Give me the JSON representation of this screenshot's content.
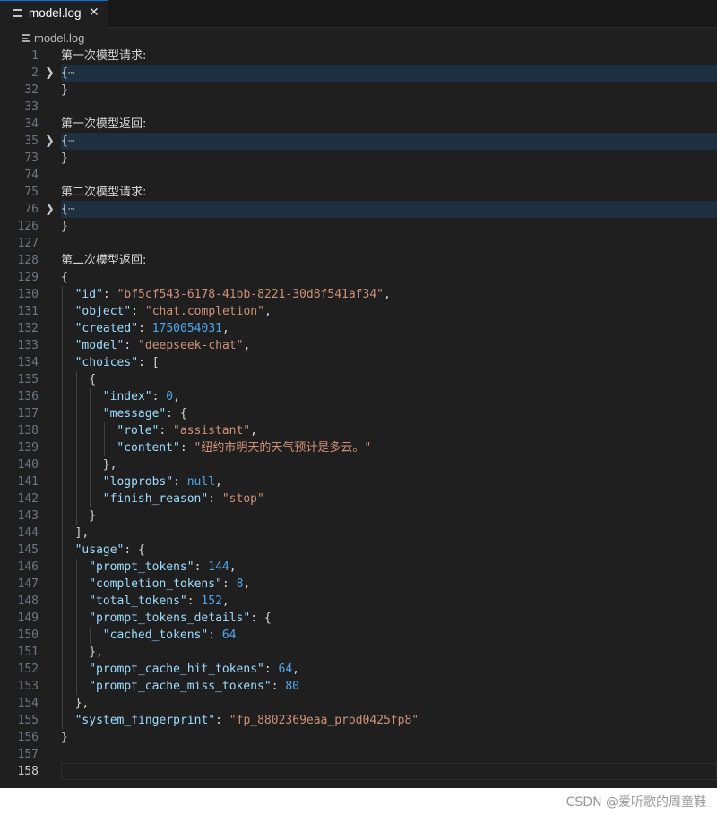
{
  "tab": {
    "label": "model.log",
    "icon": "file-lines-icon",
    "close_glyph": "✕"
  },
  "breadcrumb": {
    "label": "model.log",
    "icon": "file-lines-icon"
  },
  "lines": [
    {
      "n": "1",
      "indent": 0,
      "tokens": [
        [
          "c",
          "第一次模型请求:"
        ]
      ]
    },
    {
      "n": "2",
      "indent": 0,
      "fold": true,
      "tokens": [
        [
          "p",
          "{"
        ],
        [
          "d",
          "⋯"
        ]
      ]
    },
    {
      "n": "32",
      "indent": 0,
      "tokens": [
        [
          "p",
          "}"
        ]
      ]
    },
    {
      "n": "33",
      "indent": 0,
      "tokens": []
    },
    {
      "n": "34",
      "indent": 0,
      "tokens": [
        [
          "c",
          "第一次模型返回:"
        ]
      ]
    },
    {
      "n": "35",
      "indent": 0,
      "fold": true,
      "tokens": [
        [
          "p",
          "{"
        ],
        [
          "d",
          "⋯"
        ]
      ]
    },
    {
      "n": "73",
      "indent": 0,
      "tokens": [
        [
          "p",
          "}"
        ]
      ]
    },
    {
      "n": "74",
      "indent": 0,
      "tokens": []
    },
    {
      "n": "75",
      "indent": 0,
      "tokens": [
        [
          "c",
          "第二次模型请求:"
        ]
      ]
    },
    {
      "n": "76",
      "indent": 0,
      "fold": true,
      "tokens": [
        [
          "p",
          "{"
        ],
        [
          "d",
          "⋯"
        ]
      ]
    },
    {
      "n": "126",
      "indent": 0,
      "tokens": [
        [
          "p",
          "}"
        ]
      ]
    },
    {
      "n": "127",
      "indent": 0,
      "tokens": []
    },
    {
      "n": "128",
      "indent": 0,
      "tokens": [
        [
          "c",
          "第二次模型返回:"
        ]
      ]
    },
    {
      "n": "129",
      "indent": 0,
      "tokens": [
        [
          "p",
          "{"
        ]
      ]
    },
    {
      "n": "130",
      "indent": 1,
      "tokens": [
        [
          "k",
          "\"id\""
        ],
        [
          "p",
          ": "
        ],
        [
          "s",
          "\"bf5cf543-6178-41bb-8221-30d8f541af34\""
        ],
        [
          "p",
          ","
        ]
      ]
    },
    {
      "n": "131",
      "indent": 1,
      "tokens": [
        [
          "k",
          "\"object\""
        ],
        [
          "p",
          ": "
        ],
        [
          "s",
          "\"chat.completion\""
        ],
        [
          "p",
          ","
        ]
      ]
    },
    {
      "n": "132",
      "indent": 1,
      "tokens": [
        [
          "k",
          "\"created\""
        ],
        [
          "p",
          ": "
        ],
        [
          "n",
          "1750054031"
        ],
        [
          "p",
          ","
        ]
      ]
    },
    {
      "n": "133",
      "indent": 1,
      "tokens": [
        [
          "k",
          "\"model\""
        ],
        [
          "p",
          ": "
        ],
        [
          "s",
          "\"deepseek-chat\""
        ],
        [
          "p",
          ","
        ]
      ]
    },
    {
      "n": "134",
      "indent": 1,
      "tokens": [
        [
          "k",
          "\"choices\""
        ],
        [
          "p",
          ": ["
        ]
      ]
    },
    {
      "n": "135",
      "indent": 2,
      "tokens": [
        [
          "p",
          "{"
        ]
      ]
    },
    {
      "n": "136",
      "indent": 3,
      "tokens": [
        [
          "k",
          "\"index\""
        ],
        [
          "p",
          ": "
        ],
        [
          "n",
          "0"
        ],
        [
          "p",
          ","
        ]
      ]
    },
    {
      "n": "137",
      "indent": 3,
      "tokens": [
        [
          "k",
          "\"message\""
        ],
        [
          "p",
          ": {"
        ]
      ]
    },
    {
      "n": "138",
      "indent": 4,
      "tokens": [
        [
          "k",
          "\"role\""
        ],
        [
          "p",
          ": "
        ],
        [
          "s",
          "\"assistant\""
        ],
        [
          "p",
          ","
        ]
      ]
    },
    {
      "n": "139",
      "indent": 4,
      "tokens": [
        [
          "k",
          "\"content\""
        ],
        [
          "p",
          ": "
        ],
        [
          "s",
          "\"纽约市明天的天气预计是多云。\""
        ]
      ]
    },
    {
      "n": "140",
      "indent": 3,
      "tokens": [
        [
          "p",
          "},"
        ]
      ]
    },
    {
      "n": "141",
      "indent": 3,
      "tokens": [
        [
          "k",
          "\"logprobs\""
        ],
        [
          "p",
          ": "
        ],
        [
          "w",
          "null"
        ],
        [
          "p",
          ","
        ]
      ]
    },
    {
      "n": "142",
      "indent": 3,
      "tokens": [
        [
          "k",
          "\"finish_reason\""
        ],
        [
          "p",
          ": "
        ],
        [
          "s",
          "\"stop\""
        ]
      ]
    },
    {
      "n": "143",
      "indent": 2,
      "tokens": [
        [
          "p",
          "}"
        ]
      ]
    },
    {
      "n": "144",
      "indent": 1,
      "tokens": [
        [
          "p",
          "],"
        ]
      ]
    },
    {
      "n": "145",
      "indent": 1,
      "tokens": [
        [
          "k",
          "\"usage\""
        ],
        [
          "p",
          ": {"
        ]
      ]
    },
    {
      "n": "146",
      "indent": 2,
      "tokens": [
        [
          "k",
          "\"prompt_tokens\""
        ],
        [
          "p",
          ": "
        ],
        [
          "n",
          "144"
        ],
        [
          "p",
          ","
        ]
      ]
    },
    {
      "n": "147",
      "indent": 2,
      "tokens": [
        [
          "k",
          "\"completion_tokens\""
        ],
        [
          "p",
          ": "
        ],
        [
          "n",
          "8"
        ],
        [
          "p",
          ","
        ]
      ]
    },
    {
      "n": "148",
      "indent": 2,
      "tokens": [
        [
          "k",
          "\"total_tokens\""
        ],
        [
          "p",
          ": "
        ],
        [
          "n",
          "152"
        ],
        [
          "p",
          ","
        ]
      ]
    },
    {
      "n": "149",
      "indent": 2,
      "tokens": [
        [
          "k",
          "\"prompt_tokens_details\""
        ],
        [
          "p",
          ": {"
        ]
      ]
    },
    {
      "n": "150",
      "indent": 3,
      "tokens": [
        [
          "k",
          "\"cached_tokens\""
        ],
        [
          "p",
          ": "
        ],
        [
          "n",
          "64"
        ]
      ]
    },
    {
      "n": "151",
      "indent": 2,
      "tokens": [
        [
          "p",
          "},"
        ]
      ]
    },
    {
      "n": "152",
      "indent": 2,
      "tokens": [
        [
          "k",
          "\"prompt_cache_hit_tokens\""
        ],
        [
          "p",
          ": "
        ],
        [
          "n",
          "64"
        ],
        [
          "p",
          ","
        ]
      ]
    },
    {
      "n": "153",
      "indent": 2,
      "tokens": [
        [
          "k",
          "\"prompt_cache_miss_tokens\""
        ],
        [
          "p",
          ": "
        ],
        [
          "n",
          "80"
        ]
      ]
    },
    {
      "n": "154",
      "indent": 1,
      "tokens": [
        [
          "p",
          "},"
        ]
      ]
    },
    {
      "n": "155",
      "indent": 1,
      "tokens": [
        [
          "k",
          "\"system_fingerprint\""
        ],
        [
          "p",
          ": "
        ],
        [
          "s",
          "\"fp_8802369eaa_prod0425fp8\""
        ]
      ]
    },
    {
      "n": "156",
      "indent": 0,
      "tokens": [
        [
          "p",
          "}"
        ]
      ]
    },
    {
      "n": "157",
      "indent": 0,
      "tokens": []
    },
    {
      "n": "158",
      "indent": 0,
      "current": true,
      "tokens": []
    }
  ],
  "fold_glyph": "❯",
  "watermark": "CSDN @爱听歌的周童鞋",
  "colors": {
    "background": "#1f1f1f",
    "key": "#9cdcfe",
    "string": "#ce9178",
    "number": "#4fa6ee",
    "fold_highlight": "#1e3040",
    "accent": "#0078d4"
  }
}
